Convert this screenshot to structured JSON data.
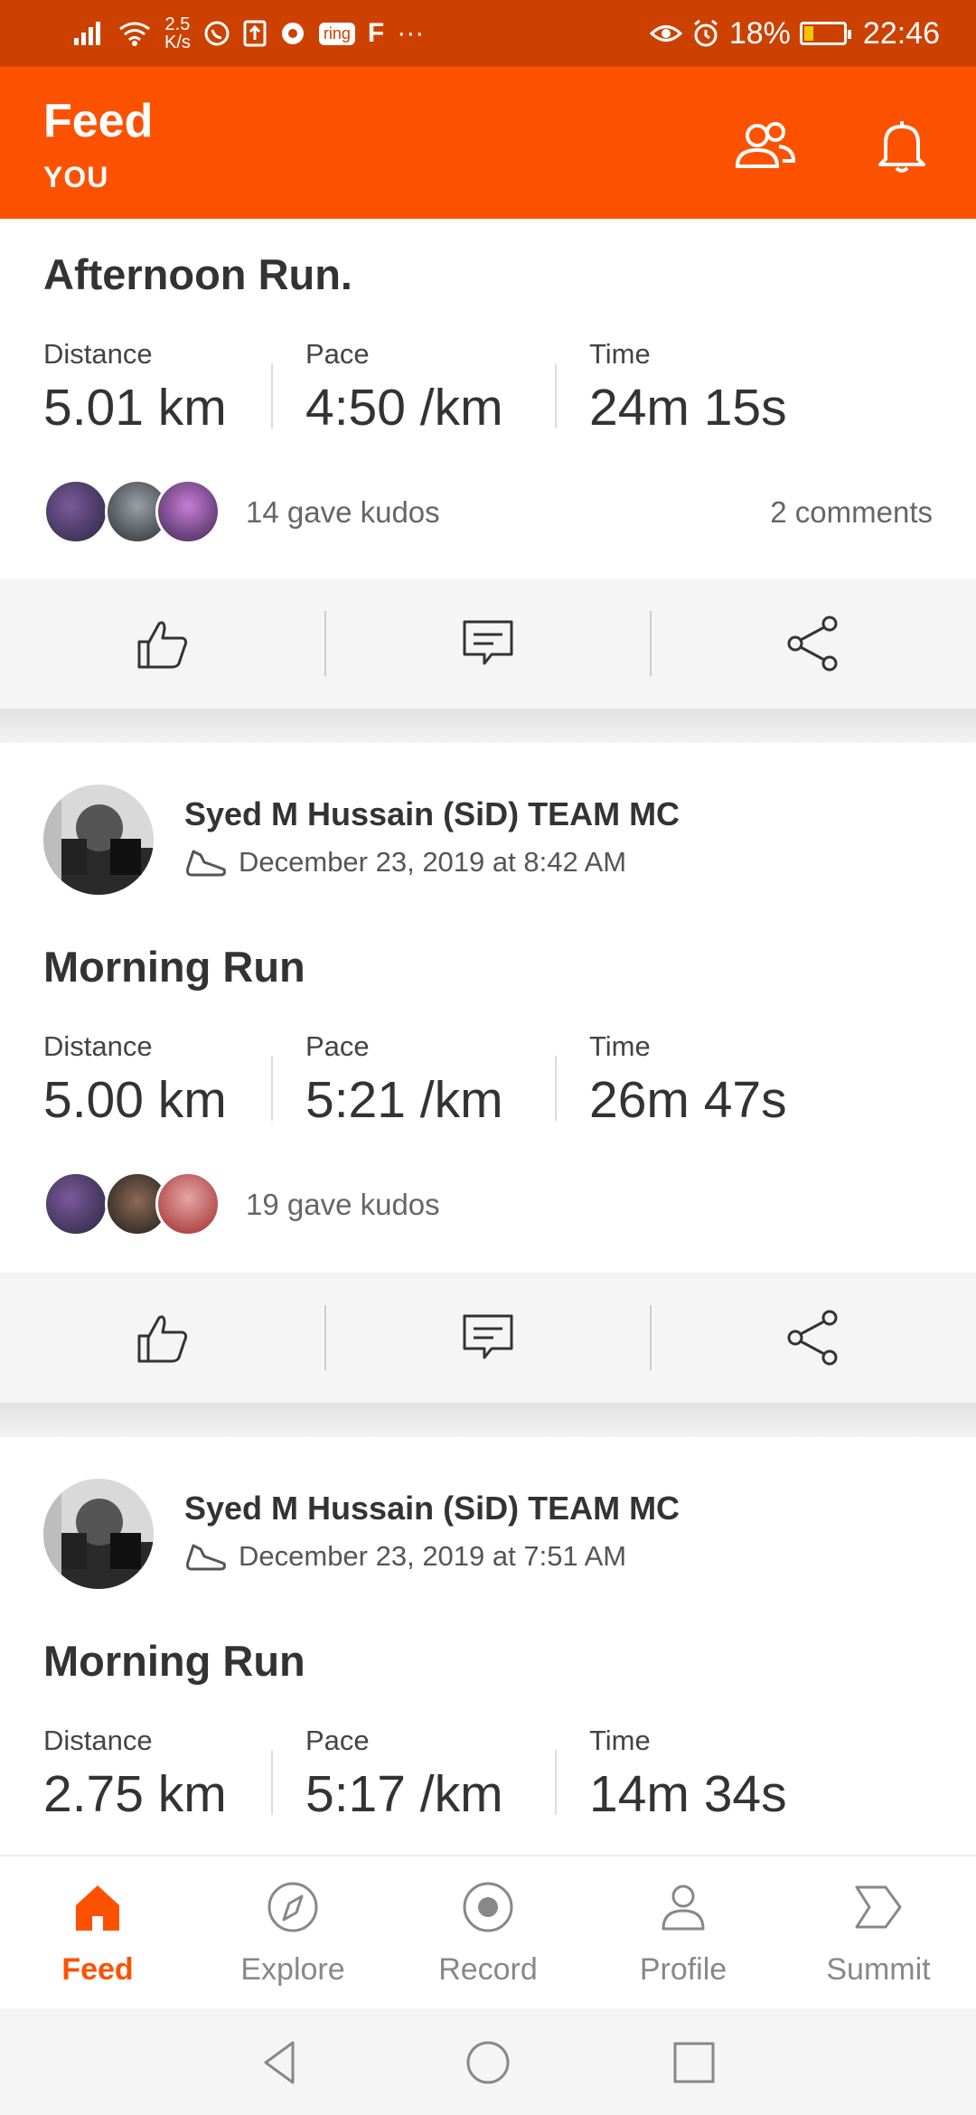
{
  "status_bar": {
    "net_speed_value": "2.5",
    "net_speed_unit": "K/s",
    "ring_label": "ring",
    "f_label": "F",
    "more_label": "···",
    "battery": "18%",
    "time": "22:46"
  },
  "header": {
    "title": "Feed",
    "subtitle": "YOU"
  },
  "feed": {
    "activities": [
      {
        "title": "Afternoon Run.",
        "stats": [
          {
            "label": "Distance",
            "value": "5.01 km"
          },
          {
            "label": "Pace",
            "value": "4:50 /km"
          },
          {
            "label": "Time",
            "value": "24m 15s"
          }
        ],
        "kudos": "14 gave kudos",
        "comments": "2 comments"
      },
      {
        "athlete": "Syed M Hussain (SiD) TEAM MC",
        "datetime": "December 23, 2019 at 8:42 AM",
        "title": "Morning Run",
        "stats": [
          {
            "label": "Distance",
            "value": "5.00 km"
          },
          {
            "label": "Pace",
            "value": "5:21 /km"
          },
          {
            "label": "Time",
            "value": "26m 47s"
          }
        ],
        "kudos": "19 gave kudos"
      },
      {
        "athlete": "Syed M Hussain (SiD) TEAM MC",
        "datetime": "December 23, 2019 at 7:51 AM",
        "title": "Morning Run",
        "stats": [
          {
            "label": "Distance",
            "value": "2.75 km"
          },
          {
            "label": "Pace",
            "value": "5:17 /km"
          },
          {
            "label": "Time",
            "value": "14m 34s"
          }
        ]
      }
    ]
  },
  "bottom_nav": {
    "items": [
      {
        "label": "Feed",
        "icon": "home-icon",
        "active": true
      },
      {
        "label": "Explore",
        "icon": "compass-icon"
      },
      {
        "label": "Record",
        "icon": "record-icon"
      },
      {
        "label": "Profile",
        "icon": "person-icon"
      },
      {
        "label": "Summit",
        "icon": "summit-icon"
      }
    ]
  },
  "colors": {
    "brand": "#fc5200",
    "status_bar": "#cc4100"
  }
}
